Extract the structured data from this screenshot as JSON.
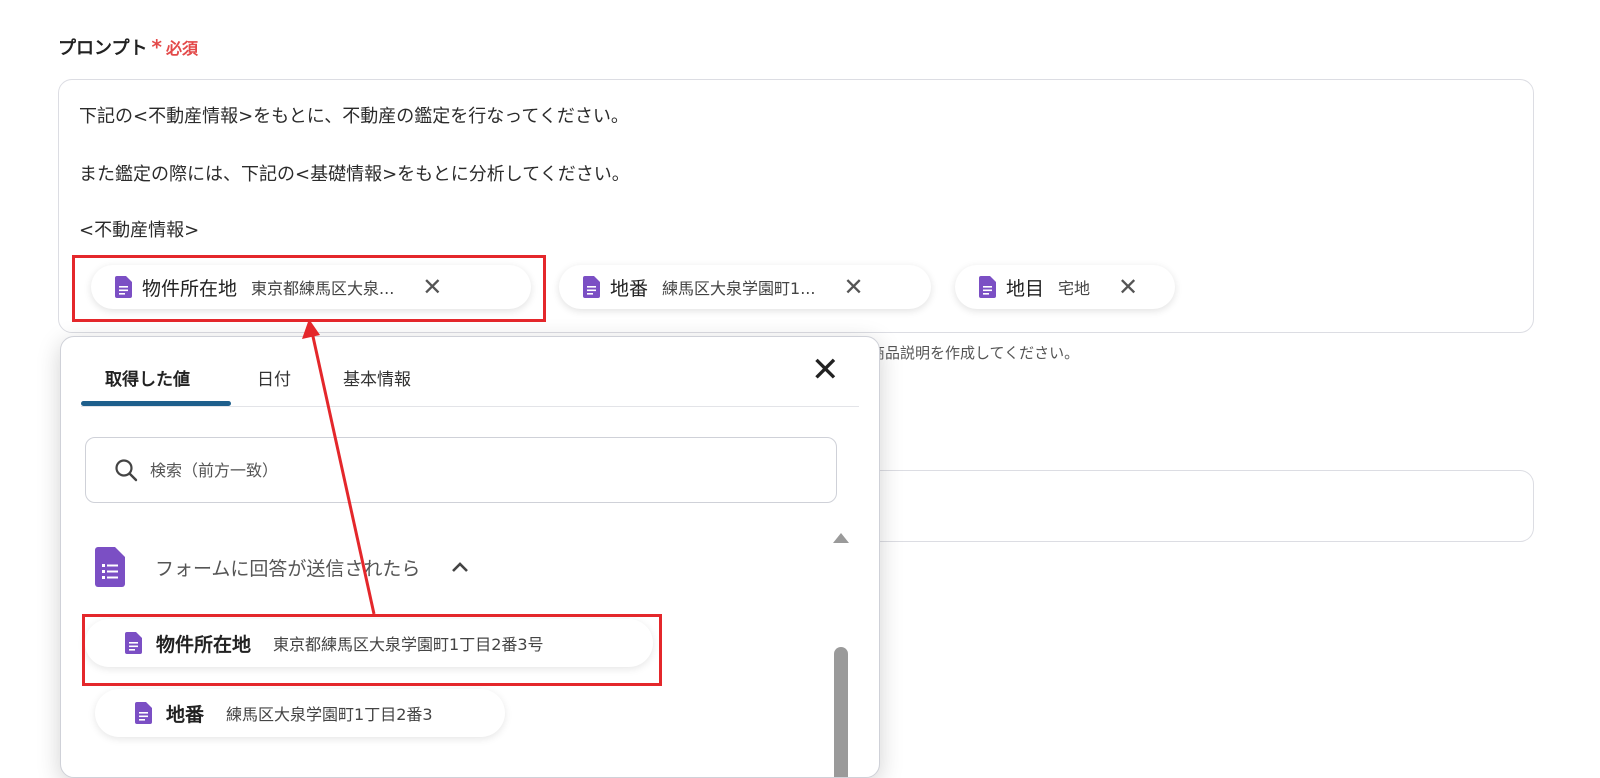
{
  "field": {
    "label": "プロンプト",
    "required_mark": "*",
    "required_text": "必須"
  },
  "prompt": {
    "line1": "下記の<不動産情報>をもとに、不動産の鑑定を行なってください。",
    "line2": "また鑑定の際には、下記の<基礎情報>をもとに分析してください。",
    "line3": "<不動産情報>",
    "chips": [
      {
        "key": "物件所在地",
        "value": "東京都練馬区大泉..."
      },
      {
        "key": "地番",
        "value": "練馬区大泉学園町1..."
      },
      {
        "key": "地目",
        "value": "宅地"
      }
    ],
    "close_glyph": "✕"
  },
  "hint": "商品説明を作成してください。",
  "dropdown": {
    "tabs": [
      "取得した値",
      "日付",
      "基本情報"
    ],
    "active_tab": 0,
    "close_glyph": "✕",
    "search_placeholder": "検索（前方一致）",
    "group_label": "フォームに回答が送信されたら",
    "group_chevron": "^",
    "items": [
      {
        "key": "物件所在地",
        "value": "東京都練馬区大泉学園町1丁目2番3号"
      },
      {
        "key": "地番",
        "value": "練馬区大泉学園町1丁目2番3"
      }
    ]
  },
  "colors": {
    "accent_red": "#e4272b",
    "doc_icon": "#7b4fc4",
    "tab_underline": "#1e5f8c"
  },
  "icons": [
    "document-icon",
    "close-icon",
    "search-icon",
    "chevron-up-icon"
  ]
}
